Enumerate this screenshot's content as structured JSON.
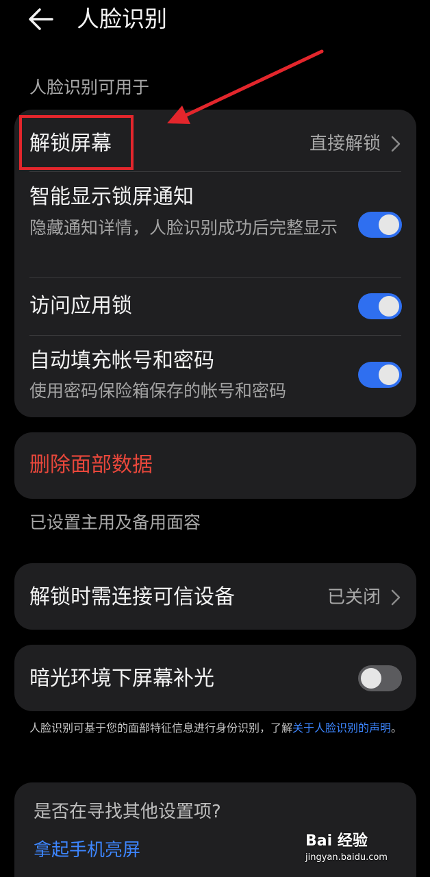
{
  "header": {
    "title": "人脸识别"
  },
  "section_top": {
    "label": "人脸识别可用于"
  },
  "card1": {
    "unlock_screen": {
      "title": "解锁屏幕",
      "value": "直接解锁"
    },
    "smart_notifications": {
      "title": "智能显示锁屏通知",
      "subtitle": "隐藏通知详情，人脸识别成功后完整显示",
      "enabled": true
    },
    "app_lock": {
      "title": "访问应用锁",
      "enabled": true
    },
    "autofill": {
      "title": "自动填充帐号和密码",
      "subtitle": "使用密码保险箱保存的帐号和密码",
      "enabled": true
    }
  },
  "delete": {
    "label": "删除面部数据"
  },
  "section_faces": {
    "label": "已设置主用及备用面容"
  },
  "trusted_device": {
    "title": "解锁时需连接可信设备",
    "value": "已关闭"
  },
  "low_light": {
    "title": "暗光环境下屏幕补光",
    "enabled": false
  },
  "footnote": {
    "text": "人脸识别可基于您的面部特征信息进行身份识别，了解",
    "link": "关于人脸识别的声明",
    "end": "。"
  },
  "suggestions": {
    "question": "是否在寻找其他设置项?",
    "link": "拿起手机亮屏"
  },
  "watermark": {
    "brand": "Bai 经验",
    "url": "jingyan.baidu.com"
  },
  "colors": {
    "accent": "#2f6ff0",
    "link": "#3d86ff",
    "danger": "#e8473b",
    "annotation": "#e3262c",
    "card": "#1f1f21"
  }
}
